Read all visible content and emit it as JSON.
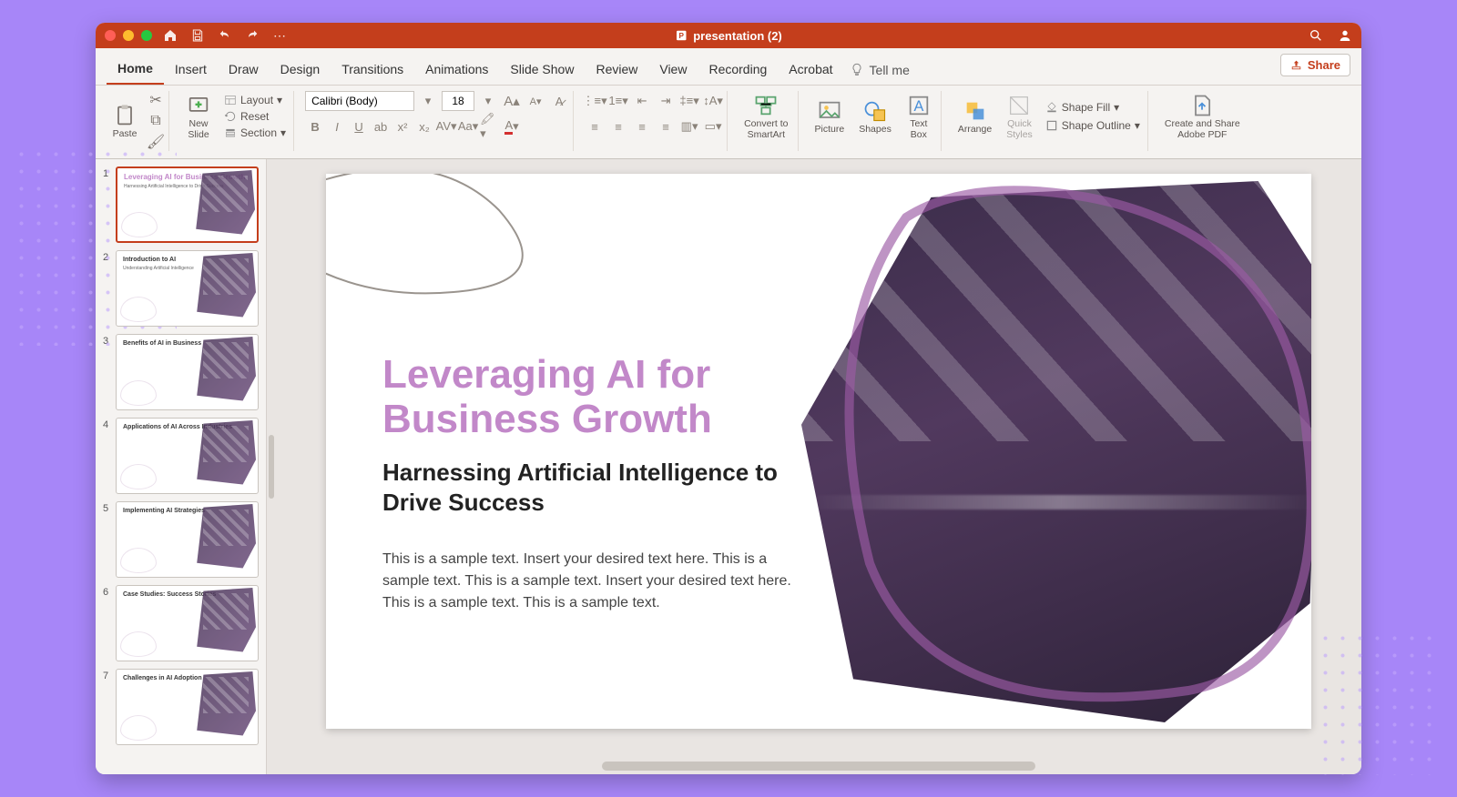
{
  "titlebar": {
    "document": "presentation (2)"
  },
  "tabs": [
    "Home",
    "Insert",
    "Draw",
    "Design",
    "Transitions",
    "Animations",
    "Slide Show",
    "Review",
    "View",
    "Recording",
    "Acrobat"
  ],
  "active_tab": "Home",
  "tellme": "Tell me",
  "share": "Share",
  "ribbon": {
    "paste": "Paste",
    "newslide": "New\nSlide",
    "layout": "Layout",
    "reset": "Reset",
    "section": "Section",
    "font_name": "Calibri (Body)",
    "font_size": "18",
    "convert": "Convert to\nSmartArt",
    "picture": "Picture",
    "shapes": "Shapes",
    "textbox": "Text\nBox",
    "arrange": "Arrange",
    "quick": "Quick\nStyles",
    "shapefill": "Shape Fill",
    "shapeoutline": "Shape Outline",
    "adobe": "Create and Share\nAdobe PDF"
  },
  "thumbs": [
    {
      "n": "1",
      "title": "Leveraging AI for Business Growth",
      "sub": "Harnessing Artificial Intelligence to Drive Success",
      "pink": true
    },
    {
      "n": "2",
      "title": "Introduction to AI",
      "sub": "Understanding Artificial Intelligence"
    },
    {
      "n": "3",
      "title": "Benefits of AI in Business",
      "sub": ""
    },
    {
      "n": "4",
      "title": "Applications of AI Across Industries",
      "sub": ""
    },
    {
      "n": "5",
      "title": "Implementing AI Strategies",
      "sub": ""
    },
    {
      "n": "6",
      "title": "Case Studies: Success Stories",
      "sub": ""
    },
    {
      "n": "7",
      "title": "Challenges in AI Adoption",
      "sub": ""
    }
  ],
  "slide": {
    "title": "Leveraging AI for Business Growth",
    "subtitle": "Harnessing Artificial Intelligence to Drive Success",
    "body": "This is a sample text. Insert your desired text here. This is a sample text. This is a sample text. Insert your desired text here. This is a sample text. This is a sample text."
  }
}
